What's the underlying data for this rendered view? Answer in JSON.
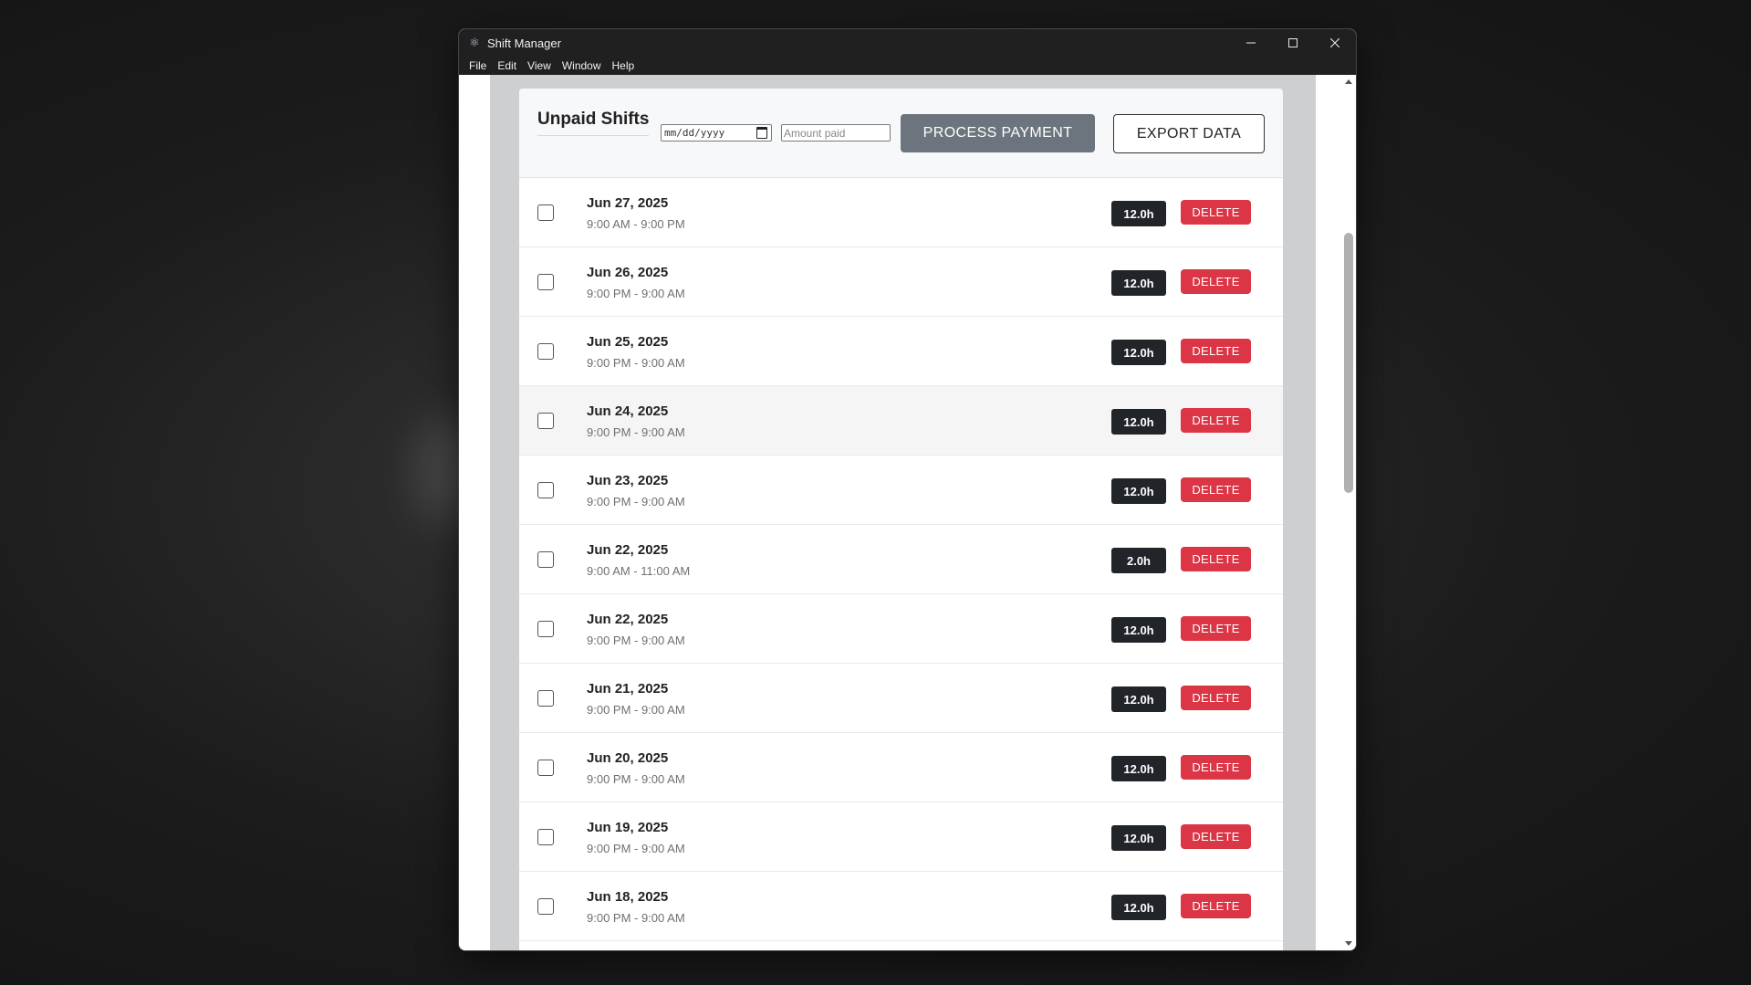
{
  "window": {
    "title": "Shift Manager"
  },
  "menu": [
    "File",
    "Edit",
    "View",
    "Window",
    "Help"
  ],
  "header": {
    "title": "Unpaid Shifts",
    "date_placeholder": "mm/dd/yyyy",
    "amount_placeholder": "Amount paid",
    "process_label": "PROCESS PAYMENT",
    "export_label": "EXPORT DATA"
  },
  "shifts": [
    {
      "date": "Jun 27, 2025",
      "time": "9:00 AM - 9:00 PM",
      "hours": "12.0h",
      "delete": "DELETE"
    },
    {
      "date": "Jun 26, 2025",
      "time": "9:00 PM - 9:00 AM",
      "hours": "12.0h",
      "delete": "DELETE"
    },
    {
      "date": "Jun 25, 2025",
      "time": "9:00 PM - 9:00 AM",
      "hours": "12.0h",
      "delete": "DELETE"
    },
    {
      "date": "Jun 24, 2025",
      "time": "9:00 PM - 9:00 AM",
      "hours": "12.0h",
      "delete": "DELETE"
    },
    {
      "date": "Jun 23, 2025",
      "time": "9:00 PM - 9:00 AM",
      "hours": "12.0h",
      "delete": "DELETE"
    },
    {
      "date": "Jun 22, 2025",
      "time": "9:00 AM - 11:00 AM",
      "hours": "2.0h",
      "delete": "DELETE"
    },
    {
      "date": "Jun 22, 2025",
      "time": "9:00 PM - 9:00 AM",
      "hours": "12.0h",
      "delete": "DELETE"
    },
    {
      "date": "Jun 21, 2025",
      "time": "9:00 PM - 9:00 AM",
      "hours": "12.0h",
      "delete": "DELETE"
    },
    {
      "date": "Jun 20, 2025",
      "time": "9:00 PM - 9:00 AM",
      "hours": "12.0h",
      "delete": "DELETE"
    },
    {
      "date": "Jun 19, 2025",
      "time": "9:00 PM - 9:00 AM",
      "hours": "12.0h",
      "delete": "DELETE"
    },
    {
      "date": "Jun 18, 2025",
      "time": "9:00 PM - 9:00 AM",
      "hours": "12.0h",
      "delete": "DELETE"
    }
  ],
  "colors": {
    "delete": "#dc3545",
    "badge": "#212529",
    "process": "#6c757d"
  }
}
